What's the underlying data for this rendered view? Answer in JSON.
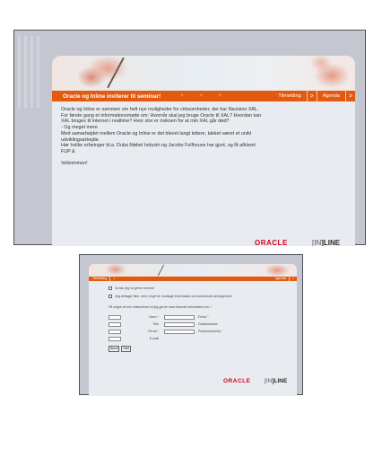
{
  "invite": {
    "title": "Oracle og Inline inviterer til seminar!",
    "arrows": "> > >",
    "nav": {
      "register_label": "Tilmelding",
      "agenda_label": "Agenda",
      "arrow": ">"
    },
    "body_lines": [
      "Oracle og Inline er sammen om helt nye muligheder for virksomheder, der har Navision XAL.",
      "For første gang et informationsmøde om: Hvornår skal jeg bruge Oracle til XAL? Hvordan kan",
      "XAL bruges til internet i realtime? Hvor stor er risikoen for at min XAL går død?",
      "- Og meget mere",
      "Med samarbejdet mellem Oracle og Inline er det blevet langt lettere, takket været et unikt",
      "udviklingsarbejde.",
      "Hør hvilke erfaringer bl.a. Duba Møbel Industri og Jacobs Fullhouse har gjort, og få afklaret",
      "FUP &"
    ],
    "welcome": "Velkommen!",
    "logos": {
      "oracle": "ORACLE",
      "inline_left": "[IN",
      "inline_right": "]LINE"
    }
  },
  "signup": {
    "nav": {
      "register_label": "Tilmelding",
      "agenda_label": "Agenda",
      "arrow": ">"
    },
    "checkbox1_label": "Ja tak, jeg vil gerne komme",
    "checkbox2_label": "Jeg deltager ikke, men vil gerne modtage information om kommende arrangement",
    "intro": "På vegne af min virksomhed vil jeg gerne have tilsendt information om: *",
    "fields_left": [
      "Navn",
      "Titel",
      "Firma",
      "E-mail"
    ],
    "fields_right": [
      "Firma",
      "Gadeadresse",
      "Postnummer/by"
    ],
    "required_mark": "*",
    "buttons": {
      "send": "Send",
      "reset": "Slet"
    },
    "logos": {
      "oracle": "ORACLE",
      "inline_left": "[IN",
      "inline_right": "]LINE"
    }
  },
  "colors": {
    "accent": "#e25a10",
    "oracle_red": "#d4001a",
    "panel": "#e8ebf0",
    "frame": "#c4c7d0"
  }
}
